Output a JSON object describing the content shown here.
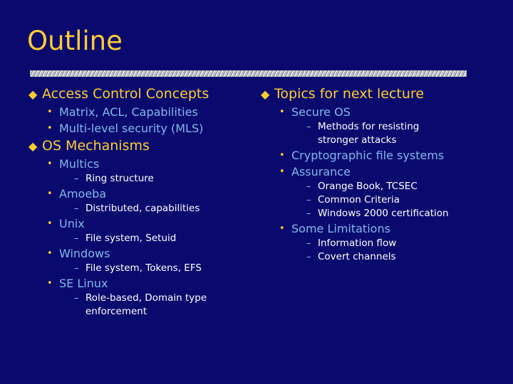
{
  "slide": {
    "title": "Outline",
    "colors": {
      "background": "#0a0a6e",
      "title": "#ffcc33",
      "level1_text": "#ffcc33",
      "level1_marker": "#ffcc33",
      "level2_text": "#7fb8e8",
      "level2_marker": "#ffcc33",
      "level3_text": "#ffffff",
      "level3_marker": "#8fc3ef",
      "divider": "#b9bcc4"
    },
    "markers": {
      "level1": "◆",
      "level2": "•",
      "level3": "–"
    },
    "left_column": [
      {
        "level": 1,
        "text": "Access Control Concepts"
      },
      {
        "level": 2,
        "text": "Matrix, ACL, Capabilities"
      },
      {
        "level": 2,
        "text": "Multi-level security (MLS)"
      },
      {
        "level": 1,
        "text": "OS Mechanisms"
      },
      {
        "level": 2,
        "text": "Multics"
      },
      {
        "level": 3,
        "text": "Ring structure"
      },
      {
        "level": 2,
        "text": "Amoeba"
      },
      {
        "level": 3,
        "text": "Distributed, capabilities"
      },
      {
        "level": 2,
        "text": "Unix"
      },
      {
        "level": 3,
        "text": "File system, Setuid"
      },
      {
        "level": 2,
        "text": "Windows"
      },
      {
        "level": 3,
        "text": "File system, Tokens, EFS"
      },
      {
        "level": 2,
        "text": "SE Linux"
      },
      {
        "level": 3,
        "text": "Role-based, Domain type enforcement"
      }
    ],
    "right_column": [
      {
        "level": 1,
        "text": "Topics for next lecture"
      },
      {
        "level": 2,
        "text": "Secure OS"
      },
      {
        "level": 3,
        "text": "Methods for resisting stronger attacks"
      },
      {
        "level": 2,
        "text": "Cryptographic file systems"
      },
      {
        "level": 2,
        "text": "Assurance"
      },
      {
        "level": 3,
        "text": "Orange Book, TCSEC"
      },
      {
        "level": 3,
        "text": "Common Criteria"
      },
      {
        "level": 3,
        "text": "Windows 2000 certification"
      },
      {
        "level": 2,
        "text": "Some Limitations"
      },
      {
        "level": 3,
        "text": "Information flow"
      },
      {
        "level": 3,
        "text": "Covert channels"
      }
    ]
  }
}
